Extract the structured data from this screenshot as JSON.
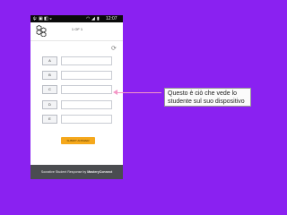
{
  "status_bar": {
    "time": "12:07",
    "icons": [
      "usb-icon",
      "image-icon",
      "bag-icon",
      "android-icon",
      "wifi-icon",
      "signal-icon",
      "battery-icon"
    ]
  },
  "header": {
    "page_counter": "1 OF 1",
    "logo_icon": "hexagon-cluster-icon"
  },
  "toolbar": {
    "refresh_icon": "refresh-icon"
  },
  "choices": [
    {
      "label": "A",
      "value": ""
    },
    {
      "label": "B",
      "value": ""
    },
    {
      "label": "C",
      "value": ""
    },
    {
      "label": "D",
      "value": ""
    },
    {
      "label": "E",
      "value": ""
    }
  ],
  "submit": {
    "label": "SUBMIT ANSWER"
  },
  "footer": {
    "prefix": "Socrative Student Response by ",
    "brand": "MasteryConnect"
  },
  "callout": {
    "text": "Questo è ciò che vede lo\nstudente sul suo dispositivo"
  },
  "colors": {
    "background": "#8a21f1",
    "accent": "#f5a81c",
    "footer": "#4a4c50",
    "pointer": "#f497c6"
  }
}
